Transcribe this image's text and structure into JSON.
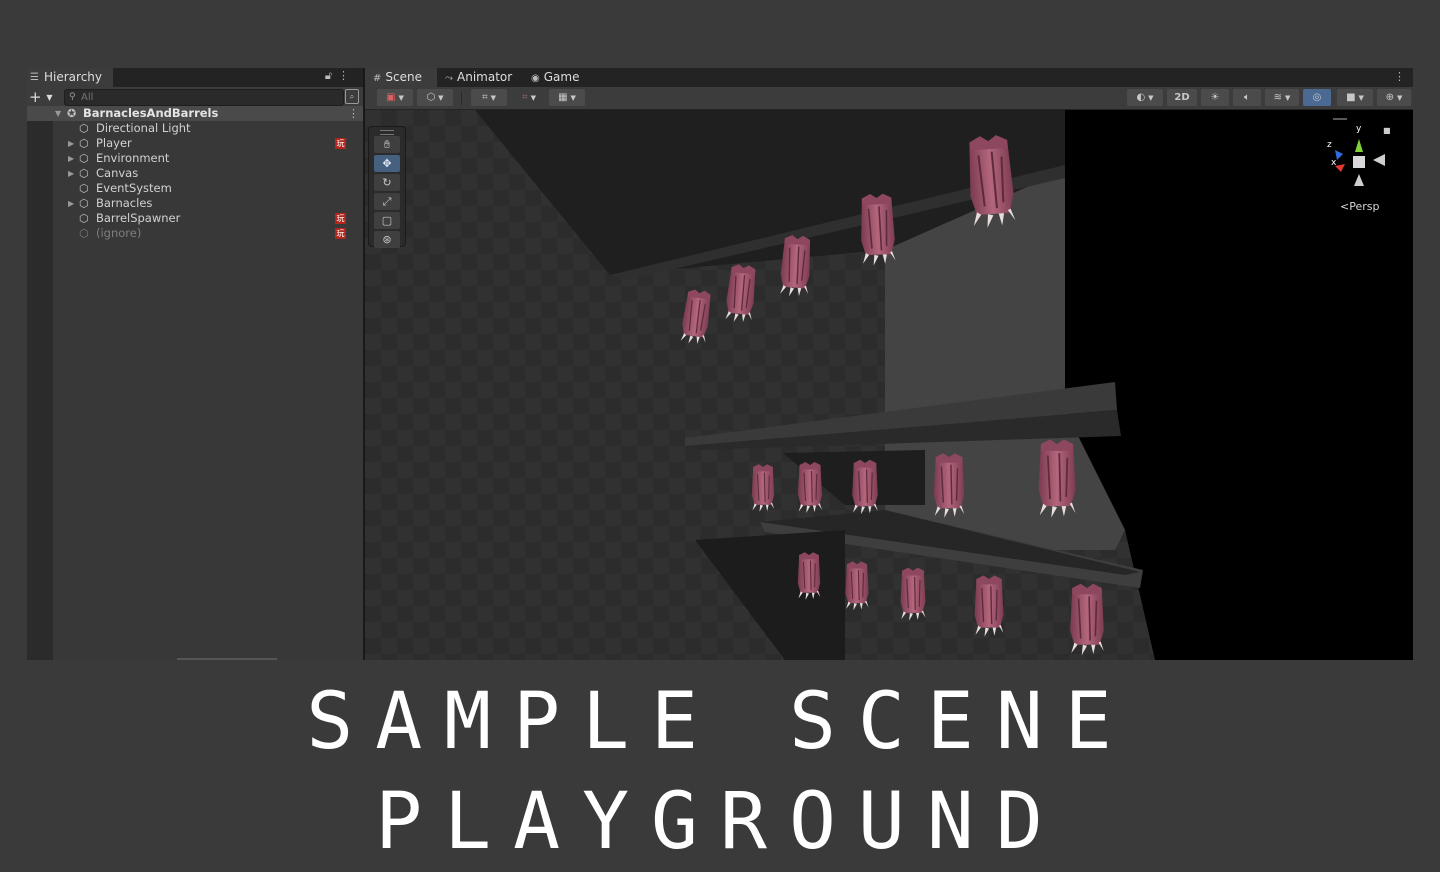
{
  "hierarchy": {
    "tab_label": "Hierarchy",
    "search_placeholder": "All",
    "add_symbol": "+",
    "rows": [
      {
        "name": "BarnaclesAndBarrels",
        "expanded": true,
        "root": true
      },
      {
        "name": "Directional Light"
      },
      {
        "name": "Player",
        "collapsed": true,
        "badge": "玩"
      },
      {
        "name": "Environment",
        "collapsed": true
      },
      {
        "name": "Canvas",
        "collapsed": true
      },
      {
        "name": "EventSystem"
      },
      {
        "name": "Barnacles",
        "collapsed": true
      },
      {
        "name": "BarrelSpawner",
        "badge": "玩"
      },
      {
        "name": "(ignore)",
        "dim": true,
        "badge": "玩"
      }
    ]
  },
  "scene": {
    "tabs": [
      {
        "label": "Scene",
        "icon": "grid-icon",
        "active": true
      },
      {
        "label": "Animator",
        "icon": "animator-icon"
      },
      {
        "label": "Game",
        "icon": "gamepad-icon"
      }
    ],
    "toolbar": {
      "mode_2d": "2D"
    },
    "gizmo": {
      "axis_y": "y",
      "axis_z": "z",
      "axis_x": "x",
      "projection": "Persp"
    }
  },
  "caption": "SAMPLE SCENE PLAYGROUND",
  "colors": {
    "background": "#3a3a3a",
    "panel": "#383838",
    "selection": "#46607f",
    "badge": "#b3261e",
    "barnacle": "#9c4a64"
  }
}
